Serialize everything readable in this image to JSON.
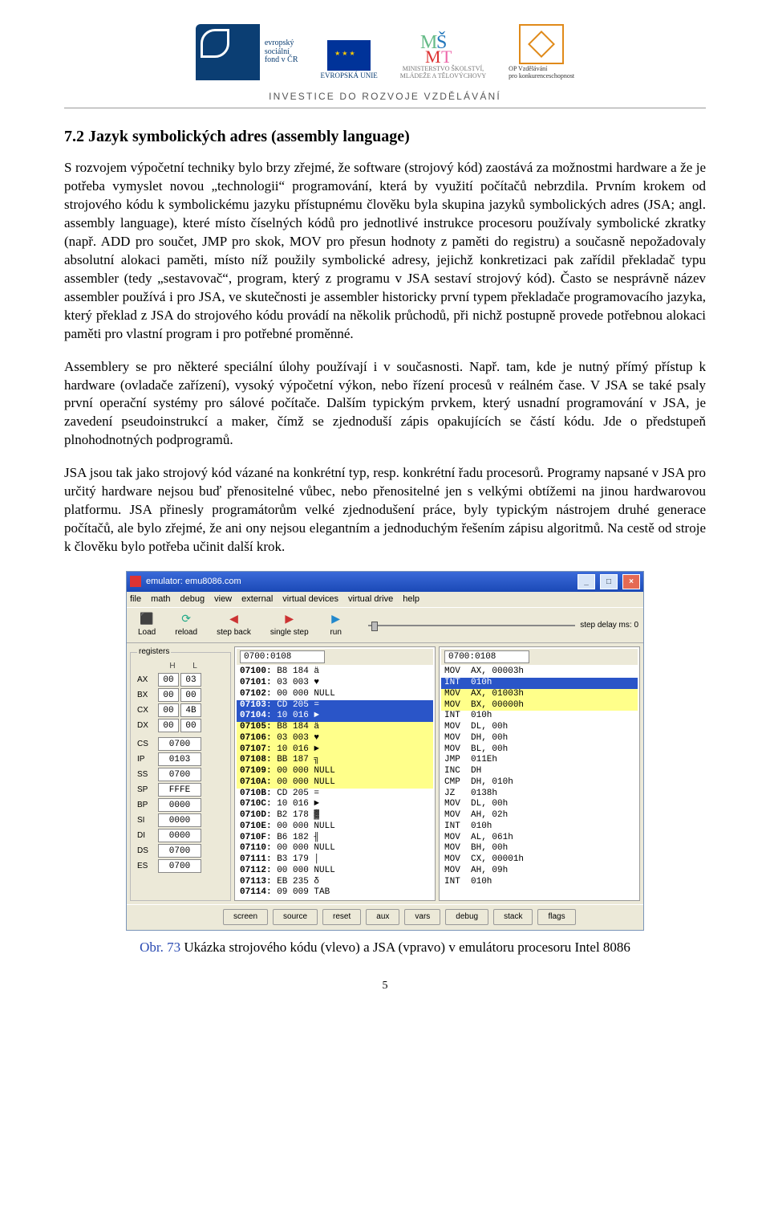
{
  "header": {
    "esf_text": "evropský\nsociální\nfond v ČR",
    "eu_label": "EVROPSKÁ UNIE",
    "msmt_label": "MINISTERSTVO ŠKOLSTVÍ,\nMLÁDEŽE A TĚLOVÝCHOVY",
    "op_label": "OP Vzdělávání\npro konkurenceschopnost",
    "tagline": "INVESTICE DO ROZVOJE VZDĚLÁVÁNÍ"
  },
  "heading": "7.2 Jazyk symbolických adres (assembly language)",
  "para1": "S rozvojem výpočetní techniky bylo brzy zřejmé, že software (strojový kód) zaostává za možnostmi hardware a že je potřeba vymyslet novou „technologii“ programování, která by využití počítačů nebrzdila. Prvním krokem od strojového kódu k symbolickému jazyku přístupnému člověku byla skupina jazyků symbolických adres (JSA; angl. assembly language), které místo číselných kódů pro jednotlivé instrukce procesoru používaly symbolické zkratky (např. ADD pro součet, JMP pro skok, MOV pro přesun hodnoty z paměti do registru) a současně nepožadovaly absolutní alokaci paměti, místo níž použily symbolické adresy, jejichž konkretizaci pak zařídil překladač typu assembler (tedy „sestavovač“, program, který z programu v JSA sestaví strojový kód). Často se nesprávně název assembler používá i pro JSA, ve skutečnosti je assembler historicky první typem překladače programovacího jazyka, který překlad z JSA do strojového kódu provádí na několik průchodů, při nichž postupně provede potřebnou alokaci paměti pro vlastní program i pro potřebné proměnné.",
  "para2": "Assemblery se pro některé speciální úlohy používají i v současnosti. Např. tam, kde je nutný přímý přístup k hardware (ovladače zařízení), vysoký výpočetní výkon, nebo řízení procesů v reálném čase. V JSA se také psaly první operační systémy pro sálové počítače. Dalším typickým prvkem, který usnadní programování v JSA, je zavedení pseudoinstrukcí a maker, čímž se zjednoduší zápis opakujících se částí kódu. Jde o předstupeň plnohodnotných podprogramů.",
  "para3": "JSA jsou tak jako strojový kód vázané na konkrétní typ, resp. konkrétní řadu procesorů. Programy napsané v JSA pro určitý hardware nejsou buď přenositelné vůbec, nebo přenositelné jen s velkými obtížemi na jinou hardwarovou platformu. JSA přinesly programátorům velké zjednodušení práce, byly typickým nástrojem druhé generace počítačů, ale bylo zřejmé, že ani ony nejsou elegantním a jednoduchým řešením zápisu algoritmů. Na cestě od stroje k člověku bylo potřeba učinit další krok.",
  "emu": {
    "title": "emulator: emu8086.com",
    "menus": [
      "file",
      "math",
      "debug",
      "view",
      "external",
      "virtual devices",
      "virtual drive",
      "help"
    ],
    "toolbar": [
      {
        "glyph": "⬛",
        "label": "Load",
        "color": "#2a8"
      },
      {
        "glyph": "⟳",
        "label": "reload",
        "color": "#2a8"
      },
      {
        "glyph": "◀",
        "label": "step back",
        "color": "#c33"
      },
      {
        "glyph": "▶",
        "label": "single step",
        "color": "#c33"
      },
      {
        "glyph": "▶",
        "label": "run",
        "color": "#28c"
      }
    ],
    "slider_label": "step delay ms: 0",
    "addr_left": "0700:0108",
    "addr_right": "0700:0108",
    "reg_legend": "registers",
    "reg_h": "H",
    "reg_l": "L",
    "regs8": [
      {
        "n": "AX",
        "h": "00",
        "l": "03"
      },
      {
        "n": "BX",
        "h": "00",
        "l": "00"
      },
      {
        "n": "CX",
        "h": "00",
        "l": "4B"
      },
      {
        "n": "DX",
        "h": "00",
        "l": "00"
      }
    ],
    "regs16": [
      {
        "n": "CS",
        "v": "0700"
      },
      {
        "n": "IP",
        "v": "0103"
      },
      {
        "n": "SS",
        "v": "0700"
      },
      {
        "n": "SP",
        "v": "FFFE"
      },
      {
        "n": "BP",
        "v": "0000"
      },
      {
        "n": "SI",
        "v": "0000"
      },
      {
        "n": "DI",
        "v": "0000"
      },
      {
        "n": "DS",
        "v": "0700"
      },
      {
        "n": "ES",
        "v": "0700"
      }
    ],
    "mem": [
      {
        "a": "07100",
        "b": "B8",
        "d": "184",
        "c": "ä",
        "sel": false,
        "hl": false
      },
      {
        "a": "07101",
        "b": "03",
        "d": "003",
        "c": "♥",
        "sel": false,
        "hl": false
      },
      {
        "a": "07102",
        "b": "00",
        "d": "000",
        "c": "NULL",
        "sel": false,
        "hl": false
      },
      {
        "a": "07103",
        "b": "CD",
        "d": "205",
        "c": "=",
        "sel": true,
        "hl": false
      },
      {
        "a": "07104",
        "b": "10",
        "d": "016",
        "c": "►",
        "sel": true,
        "hl": false
      },
      {
        "a": "07105",
        "b": "B8",
        "d": "184",
        "c": "ä",
        "sel": false,
        "hl": true
      },
      {
        "a": "07106",
        "b": "03",
        "d": "003",
        "c": "♥",
        "sel": false,
        "hl": true
      },
      {
        "a": "07107",
        "b": "10",
        "d": "016",
        "c": "►",
        "sel": false,
        "hl": true
      },
      {
        "a": "07108",
        "b": "BB",
        "d": "187",
        "c": "╗",
        "sel": false,
        "hl": true
      },
      {
        "a": "07109",
        "b": "00",
        "d": "000",
        "c": "NULL",
        "sel": false,
        "hl": true
      },
      {
        "a": "0710A",
        "b": "00",
        "d": "000",
        "c": "NULL",
        "sel": false,
        "hl": true
      },
      {
        "a": "0710B",
        "b": "CD",
        "d": "205",
        "c": "=",
        "sel": false,
        "hl": false
      },
      {
        "a": "0710C",
        "b": "10",
        "d": "016",
        "c": "►",
        "sel": false,
        "hl": false
      },
      {
        "a": "0710D",
        "b": "B2",
        "d": "178",
        "c": "▓",
        "sel": false,
        "hl": false
      },
      {
        "a": "0710E",
        "b": "00",
        "d": "000",
        "c": "NULL",
        "sel": false,
        "hl": false
      },
      {
        "a": "0710F",
        "b": "B6",
        "d": "182",
        "c": "╢",
        "sel": false,
        "hl": false
      },
      {
        "a": "07110",
        "b": "00",
        "d": "000",
        "c": "NULL",
        "sel": false,
        "hl": false
      },
      {
        "a": "07111",
        "b": "B3",
        "d": "179",
        "c": "│",
        "sel": false,
        "hl": false
      },
      {
        "a": "07112",
        "b": "00",
        "d": "000",
        "c": "NULL",
        "sel": false,
        "hl": false
      },
      {
        "a": "07113",
        "b": "EB",
        "d": "235",
        "c": "δ",
        "sel": false,
        "hl": false
      },
      {
        "a": "07114",
        "b": "09",
        "d": "009",
        "c": "TAB",
        "sel": false,
        "hl": false
      }
    ],
    "asm": [
      {
        "t": "MOV  AX, 00003h",
        "sel": false,
        "hl": false
      },
      {
        "t": "INT  010h",
        "sel": true,
        "hl": false
      },
      {
        "t": "MOV  AX, 01003h",
        "sel": false,
        "hl": true
      },
      {
        "t": "MOV  BX, 00000h",
        "sel": false,
        "hl": true
      },
      {
        "t": "INT  010h",
        "sel": false,
        "hl": false
      },
      {
        "t": "MOV  DL, 00h",
        "sel": false,
        "hl": false
      },
      {
        "t": "MOV  DH, 00h",
        "sel": false,
        "hl": false
      },
      {
        "t": "MOV  BL, 00h",
        "sel": false,
        "hl": false
      },
      {
        "t": "JMP  011Eh",
        "sel": false,
        "hl": false
      },
      {
        "t": "INC  DH",
        "sel": false,
        "hl": false
      },
      {
        "t": "CMP  DH, 010h",
        "sel": false,
        "hl": false
      },
      {
        "t": "JZ   0138h",
        "sel": false,
        "hl": false
      },
      {
        "t": "MOV  DL, 00h",
        "sel": false,
        "hl": false
      },
      {
        "t": "MOV  AH, 02h",
        "sel": false,
        "hl": false
      },
      {
        "t": "INT  010h",
        "sel": false,
        "hl": false
      },
      {
        "t": "MOV  AL, 061h",
        "sel": false,
        "hl": false
      },
      {
        "t": "MOV  BH, 00h",
        "sel": false,
        "hl": false
      },
      {
        "t": "MOV  CX, 00001h",
        "sel": false,
        "hl": false
      },
      {
        "t": "MOV  AH, 09h",
        "sel": false,
        "hl": false
      },
      {
        "t": "INT  010h",
        "sel": false,
        "hl": false
      }
    ],
    "bottom": [
      "screen",
      "source",
      "reset",
      "aux",
      "vars",
      "debug",
      "stack",
      "flags"
    ]
  },
  "caption_obr": "Obr. 73",
  "caption_rest": "  Ukázka strojového kódu (vlevo) a JSA (vpravo) v emulátoru procesoru Intel 8086",
  "pagenum": "5"
}
